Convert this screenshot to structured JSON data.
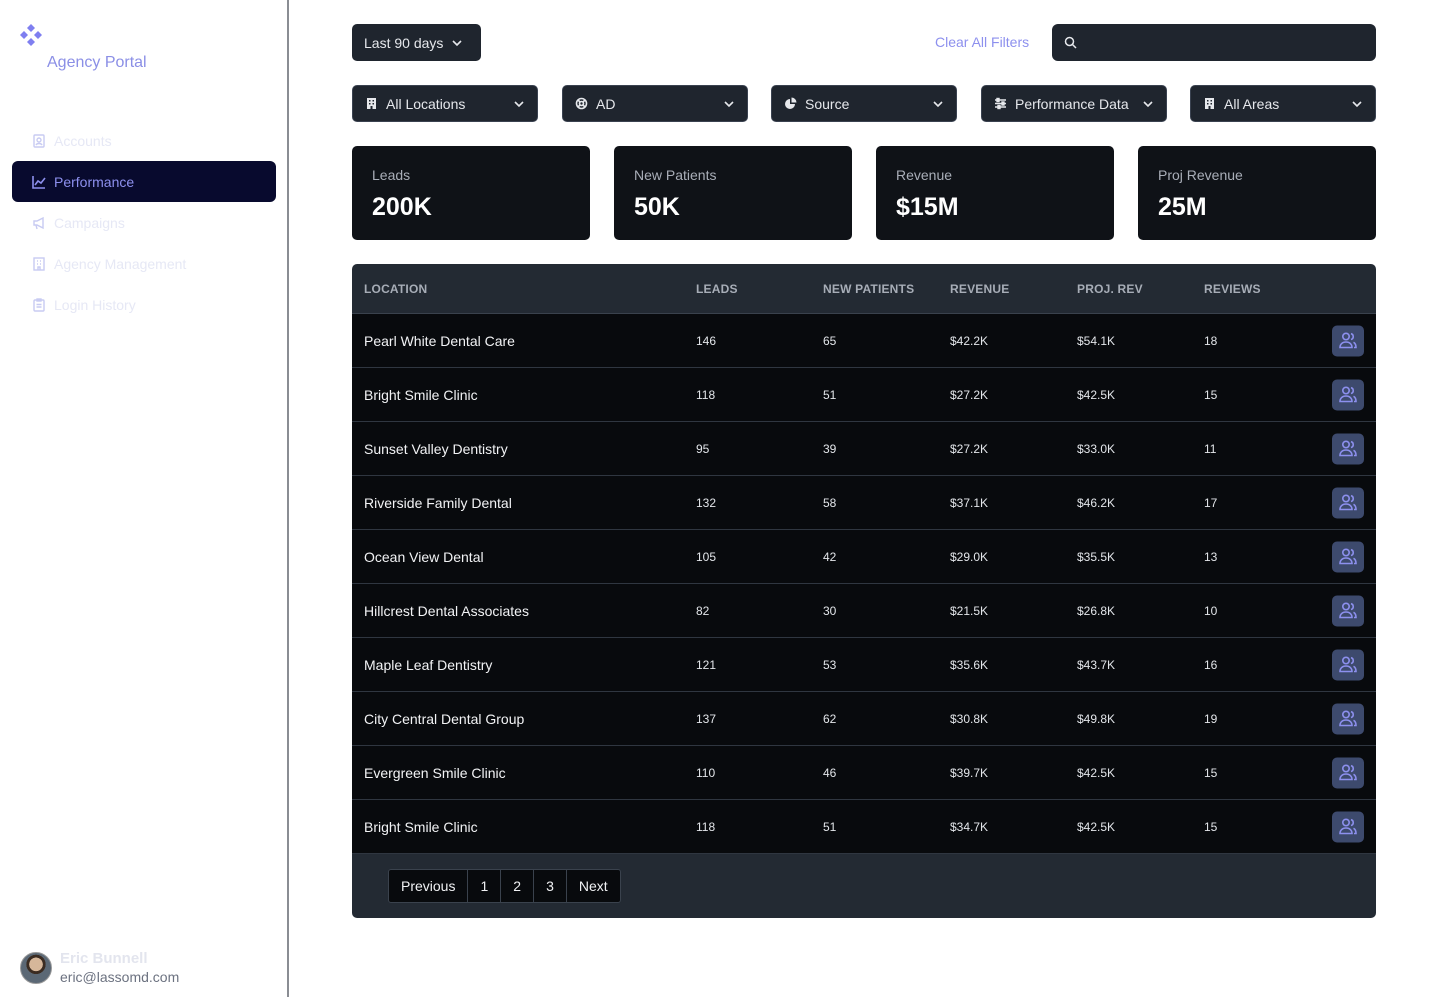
{
  "sidebar": {
    "brand": "Agency Portal",
    "items": [
      {
        "label": "Accounts",
        "icon": "contact-card-icon"
      },
      {
        "label": "Performance",
        "icon": "chart-line-icon",
        "active": true
      },
      {
        "label": "Campaigns",
        "icon": "megaphone-icon"
      },
      {
        "label": "Agency Management",
        "icon": "building-icon"
      },
      {
        "label": "Login History",
        "icon": "clipboard-icon"
      }
    ],
    "user": {
      "name": "Eric Bunnell",
      "email": "eric@lassomd.com"
    }
  },
  "toolbar": {
    "period": "Last 90 days",
    "clear_filters": "Clear All Filters",
    "search_value": ""
  },
  "filters": [
    {
      "label": "All Locations",
      "icon": "building-icon"
    },
    {
      "label": "AD",
      "icon": "lifebuoy-icon"
    },
    {
      "label": "Source",
      "icon": "pie-icon"
    },
    {
      "label": "Performance Data",
      "icon": "sliders-icon"
    },
    {
      "label": "All Areas",
      "icon": "building-icon"
    }
  ],
  "stats": [
    {
      "title": "Leads",
      "value": "200K"
    },
    {
      "title": "New Patients",
      "value": "50K"
    },
    {
      "title": "Revenue",
      "value": "$15M"
    },
    {
      "title": "Proj Revenue",
      "value": "25M"
    }
  ],
  "table": {
    "columns": [
      "LOCATION",
      "LEADS",
      "NEW PATIENTS",
      "REVENUE",
      "PROJ. REV",
      "REVIEWS"
    ],
    "rows": [
      [
        "Pearl White Dental Care",
        "146",
        "65",
        "$42.2K",
        "$54.1K",
        "18"
      ],
      [
        "Bright Smile Clinic",
        "118",
        "51",
        "$27.2K",
        "$42.5K",
        "15"
      ],
      [
        "Sunset Valley Dentistry",
        "95",
        "39",
        "$27.2K",
        "$33.0K",
        "11"
      ],
      [
        "Riverside Family Dental",
        "132",
        "58",
        "$37.1K",
        "$46.2K",
        "17"
      ],
      [
        "Ocean View Dental",
        "105",
        "42",
        "$29.0K",
        "$35.5K",
        "13"
      ],
      [
        "Hillcrest Dental Associates",
        "82",
        "30",
        "$21.5K",
        "$26.8K",
        "10"
      ],
      [
        "Maple Leaf Dentistry",
        "121",
        "53",
        "$35.6K",
        "$43.7K",
        "16"
      ],
      [
        "City Central Dental Group",
        "137",
        "62",
        "$30.8K",
        "$49.8K",
        "19"
      ],
      [
        "Evergreen Smile Clinic",
        "110",
        "46",
        "$39.7K",
        "$42.5K",
        "15"
      ],
      [
        "Bright Smile Clinic",
        "118",
        "51",
        "$34.7K",
        "$42.5K",
        "15"
      ]
    ]
  },
  "pagination": {
    "prev": "Previous",
    "pages": [
      "1",
      "2",
      "3"
    ],
    "next": "Next"
  },
  "colors": {
    "accent": "#8d90ee",
    "panel": "#232a33",
    "row": "#080a0d",
    "active_nav": "#080a2e"
  }
}
